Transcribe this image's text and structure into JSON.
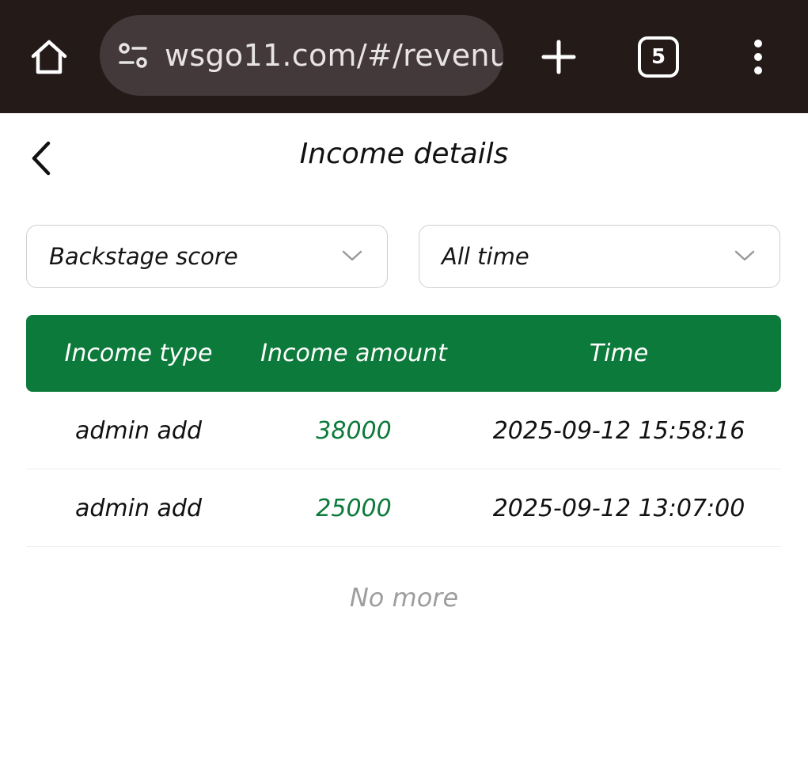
{
  "browser": {
    "url": "wsgo11.com/#/revenu",
    "tab_count": "5",
    "icons": {
      "home": "home-icon",
      "site_settings": "tune-icon",
      "new_tab": "plus-icon",
      "menu": "more-vert-icon"
    }
  },
  "page": {
    "title": "Income details",
    "back_icon": "chevron-left-icon"
  },
  "filters": {
    "type": {
      "selected": "Backstage score"
    },
    "time": {
      "selected": "All time"
    }
  },
  "table": {
    "headers": [
      "Income type",
      "Income amount",
      "Time"
    ],
    "rows": [
      {
        "type": "admin add",
        "amount": "38000",
        "time": "2025-09-12 15:58:16"
      },
      {
        "type": "admin add",
        "amount": "25000",
        "time": "2025-09-12 13:07:00"
      }
    ]
  },
  "footer": {
    "no_more": "No more"
  },
  "colors": {
    "browser_bar": "#241a18",
    "url_pill": "#43393a",
    "accent_green": "#0c7a3a",
    "muted_text": "#9e9e9e"
  }
}
